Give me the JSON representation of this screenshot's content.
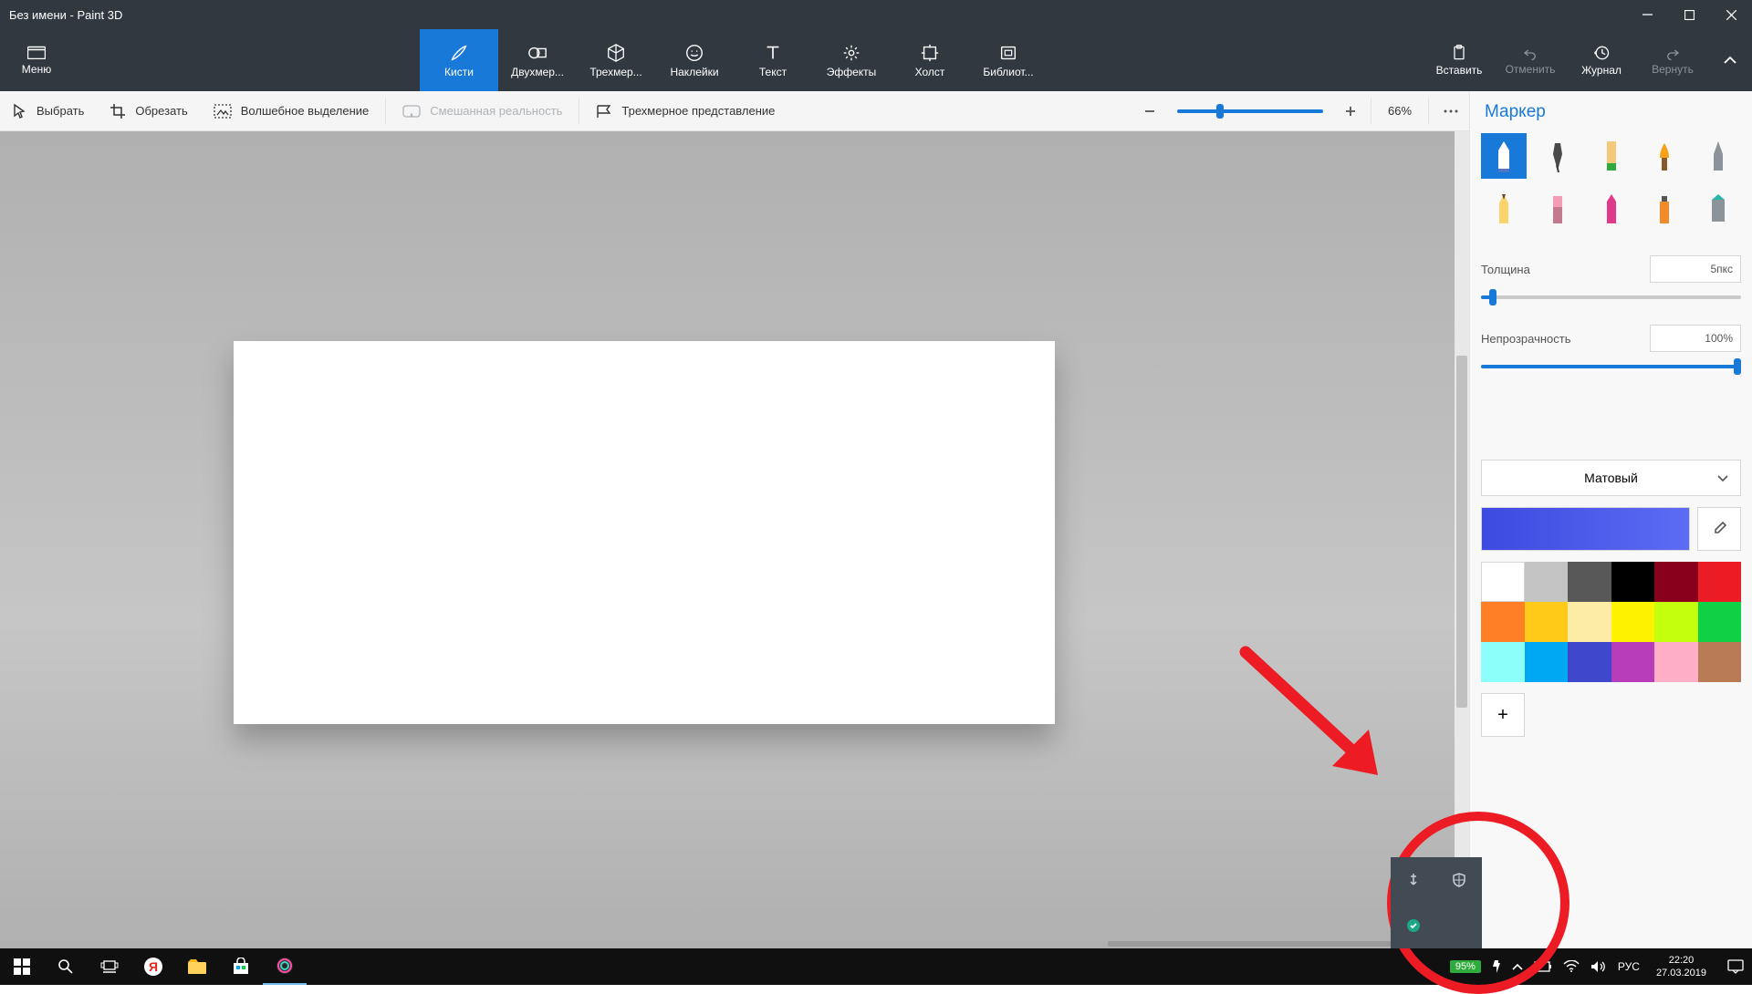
{
  "titlebar": {
    "title": "Без имени - Paint 3D"
  },
  "menu": {
    "label": "Меню"
  },
  "tabs": [
    {
      "label": "Кисти"
    },
    {
      "label": "Двухмер..."
    },
    {
      "label": "Трехмер..."
    },
    {
      "label": "Наклейки"
    },
    {
      "label": "Текст"
    },
    {
      "label": "Эффекты"
    },
    {
      "label": "Холст"
    },
    {
      "label": "Библиот..."
    }
  ],
  "rbar": {
    "insert": "Вставить",
    "undo": "Отменить",
    "history": "Журнал",
    "redo": "Вернуть"
  },
  "secondary": {
    "select": "Выбрать",
    "crop": "Обрезать",
    "magic": "Волшебное выделение",
    "mixed_reality": "Смешанная реальность",
    "view3d": "Трехмерное представление",
    "zoom_value": "66%",
    "zoom_percent": 27
  },
  "panel": {
    "title": "Маркер",
    "thickness_label": "Толщина",
    "thickness_value": "5пкс",
    "thickness_percent": 5,
    "opacity_label": "Непрозрачность",
    "opacity_value": "100%",
    "opacity_percent": 100,
    "material": "Матовый",
    "add_color": "+",
    "swatches": [
      "#ffffff",
      "#c3c3c3",
      "#585858",
      "#000000",
      "#88001b",
      "#ec1c24",
      "#ff7f27",
      "#ffca18",
      "#fdeca6",
      "#fff200",
      "#c4ff0e",
      "#0ed145",
      "#8cfffb",
      "#00a8f3",
      "#3f48cc",
      "#b83dba",
      "#ffaec8",
      "#b97a56"
    ]
  },
  "taskbar": {
    "battery": "95%",
    "lang": "РУС",
    "time": "22:20",
    "date": "27.03.2019"
  }
}
